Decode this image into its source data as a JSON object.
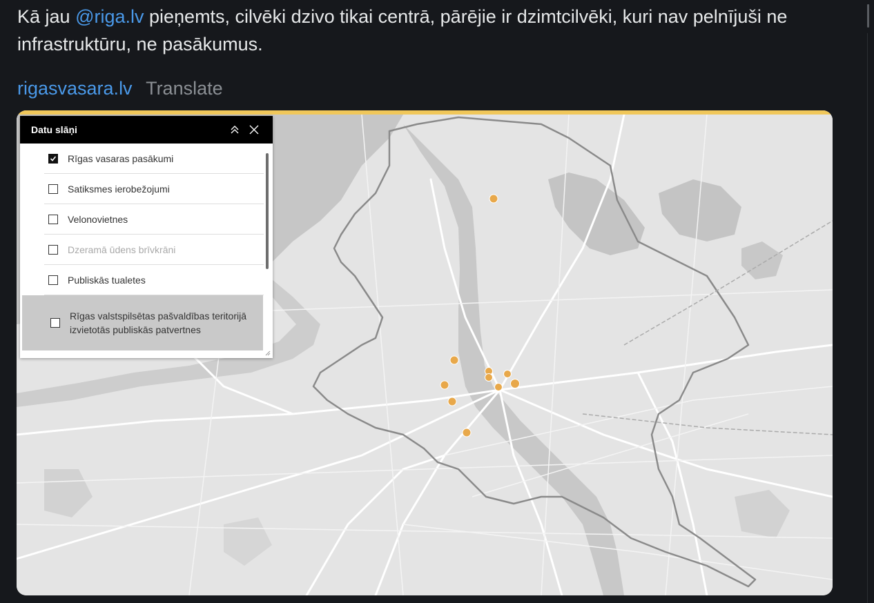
{
  "tweet": {
    "text_before": "Kā jau ",
    "mention": "@riga.lv",
    "text_after": " pieņemts, cilvēki dzivo tikai centrā, pārējie ir dzimtcilvēki, kuri nav pelnījuši ne infrastruktūru, ne pasākumus.",
    "link": "rigasvasara.lv",
    "translate": "Translate"
  },
  "panel": {
    "title": "Datu slāņi",
    "layers": [
      {
        "label": "Rīgas vasaras pasākumi",
        "checked": true,
        "enabled": true
      },
      {
        "label": "Satiksmes ierobežojumi",
        "checked": false,
        "enabled": true
      },
      {
        "label": "Velonovietnes",
        "checked": false,
        "enabled": true
      },
      {
        "label": "Dzeramā ūdens brīvkrāni",
        "checked": false,
        "enabled": false
      },
      {
        "label": "Publiskās tualetes",
        "checked": false,
        "enabled": true
      },
      {
        "label": "Rīgas valstspilsētas pašvaldības teritorijā izvietotās publiskās patvertnes",
        "checked": false,
        "enabled": true
      }
    ]
  },
  "colors": {
    "accent_bar": "#f0c75a",
    "event_marker": "#e8a84a",
    "mention": "#4a99e9"
  },
  "icons": [
    "collapse-icon",
    "close-icon",
    "checkbox-icon",
    "resize-handle-icon"
  ]
}
